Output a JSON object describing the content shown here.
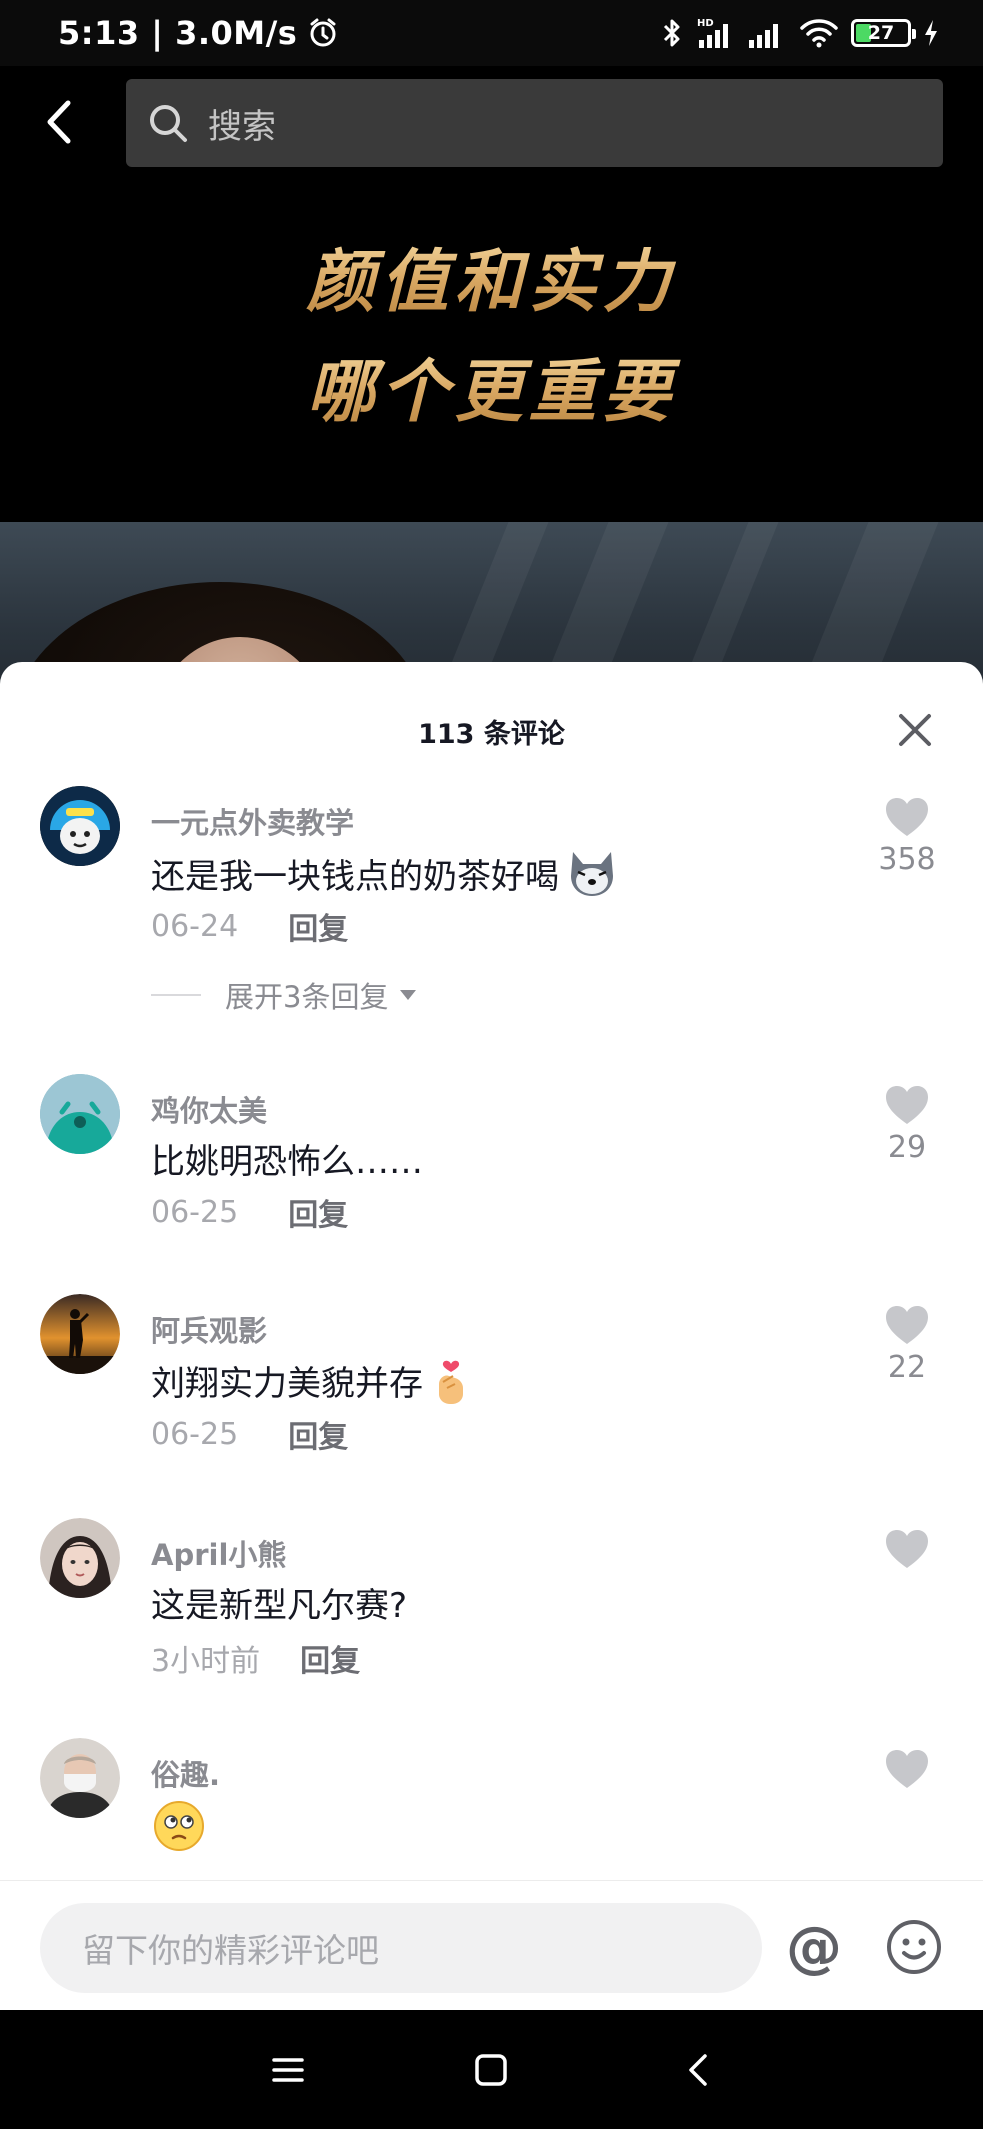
{
  "status_bar": {
    "time_speed": "5:13 | 3.0M/s",
    "network_label": "HD",
    "battery_level": "27"
  },
  "nav": {
    "search_placeholder": "搜索"
  },
  "video": {
    "overlay_line_1": "颜值和实力",
    "overlay_line_2": "哪个更重要"
  },
  "sheet": {
    "title": "113 条评论"
  },
  "comments": [
    {
      "username": "一元点外卖教学",
      "text": "还是我一块钱点的奶茶好喝",
      "emoji": "dog-emoji",
      "date": "06-24",
      "reply_label": "回复",
      "likes": "358",
      "expand_label": "展开3条回复"
    },
    {
      "username": "鸡你太美",
      "text": "比姚明恐怖么……",
      "date": "06-25",
      "reply_label": "回复",
      "likes": "29"
    },
    {
      "username": "阿兵观影",
      "text": "刘翔实力美貌并存",
      "emoji": "finger-heart-emoji",
      "date": "06-25",
      "reply_label": "回复",
      "likes": "22"
    },
    {
      "username": "April小熊",
      "text": "这是新型凡尔赛?",
      "date": "3小时前",
      "reply_label": "回复",
      "likes": ""
    },
    {
      "username": "俗趣.",
      "text": "",
      "emoji": "thinking-face-emoji",
      "likes": ""
    }
  ],
  "input_bar": {
    "placeholder": "留下你的精彩评论吧",
    "at_symbol": "@"
  },
  "colors": {
    "overlay_gold": "#e0b36c",
    "sheet_bg": "#ffffff",
    "secondary_text": "#8a8b91"
  }
}
